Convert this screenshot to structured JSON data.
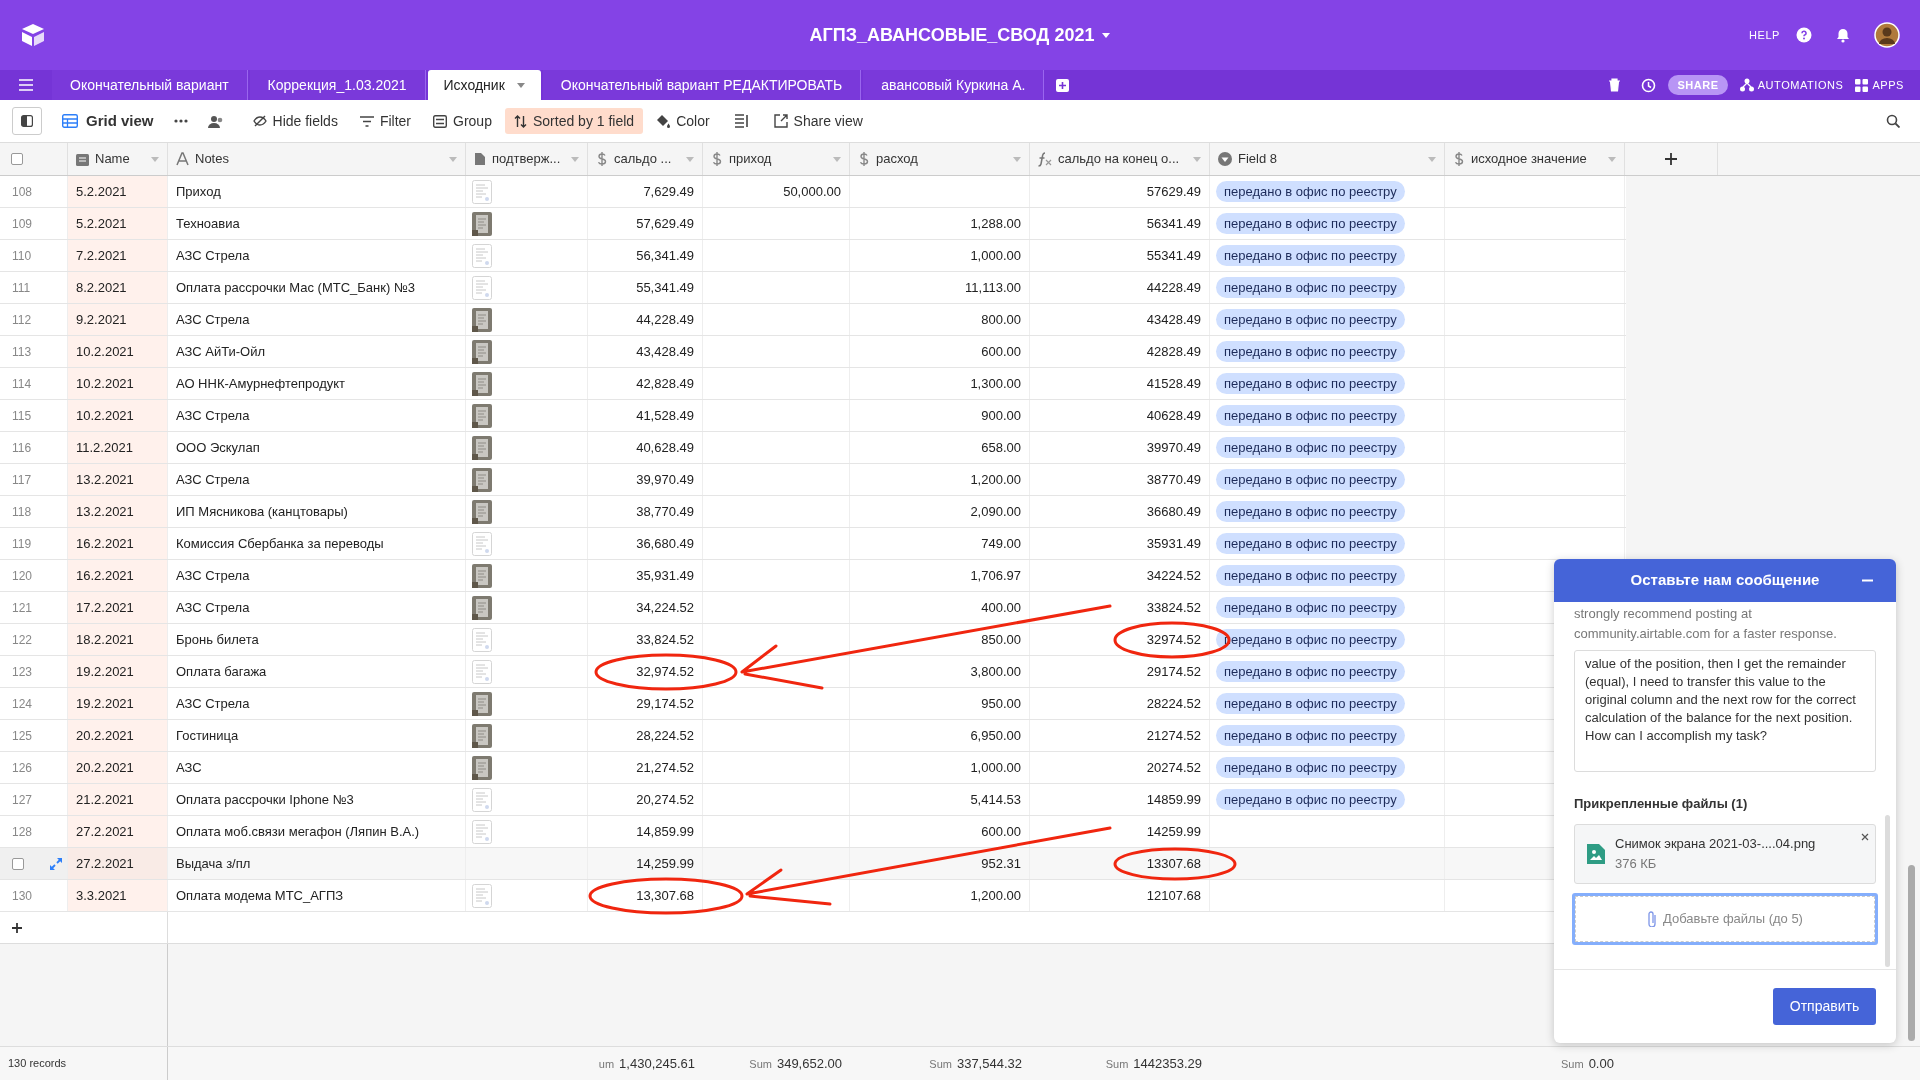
{
  "base": {
    "title": "АГПЗ_АВАНСОВЫЕ_СВОД 2021",
    "help": "HELP"
  },
  "tabs": [
    {
      "label": "Окончательный вариант",
      "selected": false
    },
    {
      "label": "Коррекция_1.03.2021",
      "selected": false
    },
    {
      "label": "Исходник",
      "selected": true
    },
    {
      "label": "Окончательный вариант РЕДАКТИРОВАТЬ",
      "selected": false
    },
    {
      "label": "авансовый Куркина А.",
      "selected": false
    }
  ],
  "tab_actions": {
    "share": "SHARE",
    "automations": "AUTOMATIONS",
    "apps": "APPS"
  },
  "toolbar": {
    "view": "Grid view",
    "buttons": [
      {
        "label": "Hide fields",
        "kind": "hide",
        "active": false
      },
      {
        "label": "Filter",
        "kind": "filter",
        "active": false
      },
      {
        "label": "Group",
        "kind": "group",
        "active": false
      },
      {
        "label": "Sorted by 1 field",
        "kind": "sort",
        "active": true
      },
      {
        "label": "Color",
        "kind": "color",
        "active": false
      }
    ],
    "share_view": "Share view"
  },
  "table": {
    "columns": [
      {
        "label": "Name",
        "kind": "date"
      },
      {
        "label": "Notes",
        "kind": "text"
      },
      {
        "label": "подтверж...",
        "kind": "attachment"
      },
      {
        "label": "сальдо ...",
        "kind": "currency",
        "summary": {
          "label": "um",
          "value": "1,430,245.61"
        }
      },
      {
        "label": "приход",
        "kind": "currency",
        "summary": {
          "label": "Sum",
          "value": "349,652.00"
        }
      },
      {
        "label": "расход",
        "kind": "currency",
        "summary": {
          "label": "Sum",
          "value": "337,544.32"
        }
      },
      {
        "label": "сальдо на конец о...",
        "kind": "formula",
        "summary": {
          "label": "Sum",
          "value": "1442353.29"
        }
      },
      {
        "label": "Field 8",
        "kind": "select"
      },
      {
        "label": "исходное значение",
        "kind": "currency",
        "summary": {
          "label": "Sum",
          "value": "0.00"
        }
      }
    ],
    "rows": [
      {
        "number": "108",
        "name": "5.2.2021",
        "notes": "Приход",
        "attachment": {
          "kind": "document"
        },
        "saldo": "7,629.49",
        "income": "50,000.00",
        "end_balance": "57629.49",
        "field_8": "передано в офис по реестру",
        "hovered": false
      },
      {
        "number": "109",
        "name": "5.2.2021",
        "notes": "Техноавиа",
        "attachment": {
          "kind": "photo"
        },
        "saldo": "57,629.49",
        "expense": "1,288.00",
        "end_balance": "56341.49",
        "field_8": "передано в офис по реестру",
        "hovered": false
      },
      {
        "number": "110",
        "name": "7.2.2021",
        "notes": "АЗС Стрела",
        "attachment": {
          "kind": "document"
        },
        "saldo": "56,341.49",
        "expense": "1,000.00",
        "end_balance": "55341.49",
        "field_8": "передано в офис по реестру",
        "hovered": false
      },
      {
        "number": "111",
        "name": "8.2.2021",
        "notes": "Оплата рассрочки Мас (МТС_Банк) №3",
        "attachment": {
          "kind": "document"
        },
        "saldo": "55,341.49",
        "expense": "11,113.00",
        "end_balance": "44228.49",
        "field_8": "передано в офис по реестру",
        "hovered": false
      },
      {
        "number": "112",
        "name": "9.2.2021",
        "notes": "АЗС Стрела",
        "attachment": {
          "kind": "photo"
        },
        "saldo": "44,228.49",
        "expense": "800.00",
        "end_balance": "43428.49",
        "field_8": "передано в офис по реестру",
        "hovered": false
      },
      {
        "number": "113",
        "name": "10.2.2021",
        "notes": "АЗС АйТи-Ойл",
        "attachment": {
          "kind": "photo"
        },
        "saldo": "43,428.49",
        "expense": "600.00",
        "end_balance": "42828.49",
        "field_8": "передано в офис по реестру",
        "hovered": false
      },
      {
        "number": "114",
        "name": "10.2.2021",
        "notes": "АО ННК-Амурнефтепродукт",
        "attachment": {
          "kind": "photo"
        },
        "saldo": "42,828.49",
        "expense": "1,300.00",
        "end_balance": "41528.49",
        "field_8": "передано в офис по реестру",
        "hovered": false
      },
      {
        "number": "115",
        "name": "10.2.2021",
        "notes": "АЗС Стрела",
        "attachment": {
          "kind": "photo"
        },
        "saldo": "41,528.49",
        "expense": "900.00",
        "end_balance": "40628.49",
        "field_8": "передано в офис по реестру",
        "hovered": false
      },
      {
        "number": "116",
        "name": "11.2.2021",
        "notes": "ООО Эскулап",
        "attachment": {
          "kind": "photo"
        },
        "saldo": "40,628.49",
        "expense": "658.00",
        "end_balance": "39970.49",
        "field_8": "передано в офис по реестру",
        "hovered": false
      },
      {
        "number": "117",
        "name": "13.2.2021",
        "notes": "АЗС Стрела",
        "attachment": {
          "kind": "photo"
        },
        "saldo": "39,970.49",
        "expense": "1,200.00",
        "end_balance": "38770.49",
        "field_8": "передано в офис по реестру",
        "hovered": false
      },
      {
        "number": "118",
        "name": "13.2.2021",
        "notes": "ИП Мясникова (канцтовары)",
        "attachment": {
          "kind": "photo"
        },
        "saldo": "38,770.49",
        "expense": "2,090.00",
        "end_balance": "36680.49",
        "field_8": "передано в офис по реестру",
        "hovered": false
      },
      {
        "number": "119",
        "name": "16.2.2021",
        "notes": "Комиссия Сбербанка за переводы",
        "attachment": {
          "kind": "document"
        },
        "saldo": "36,680.49",
        "expense": "749.00",
        "end_balance": "35931.49",
        "field_8": "передано в офис по реестру",
        "hovered": false
      },
      {
        "number": "120",
        "name": "16.2.2021",
        "notes": "АЗС Стрела",
        "attachment": {
          "kind": "photo"
        },
        "saldo": "35,931.49",
        "expense": "1,706.97",
        "end_balance": "34224.52",
        "field_8": "передано в офис по реестру",
        "hovered": false
      },
      {
        "number": "121",
        "name": "17.2.2021",
        "notes": "АЗС Стрела",
        "attachment": {
          "kind": "photo"
        },
        "saldo": "34,224.52",
        "expense": "400.00",
        "end_balance": "33824.52",
        "field_8": "передано в офис по реестру",
        "hovered": false
      },
      {
        "number": "122",
        "name": "18.2.2021",
        "notes": "Бронь билета",
        "attachment": {
          "kind": "document"
        },
        "saldo": "33,824.52",
        "expense": "850.00",
        "end_balance": "32974.52",
        "field_8": "передано в офис по реестру",
        "hovered": false
      },
      {
        "number": "123",
        "name": "19.2.2021",
        "notes": "Оплата багажа",
        "attachment": {
          "kind": "document"
        },
        "saldo": "32,974.52",
        "expense": "3,800.00",
        "end_balance": "29174.52",
        "field_8": "передано в офис по реестру",
        "hovered": false
      },
      {
        "number": "124",
        "name": "19.2.2021",
        "notes": "АЗС Стрела",
        "attachment": {
          "kind": "photo"
        },
        "saldo": "29,174.52",
        "expense": "950.00",
        "end_balance": "28224.52",
        "field_8": "передано в офис по реестру",
        "hovered": false
      },
      {
        "number": "125",
        "name": "20.2.2021",
        "notes": "Гостиница",
        "attachment": {
          "kind": "photo"
        },
        "saldo": "28,224.52",
        "expense": "6,950.00",
        "end_balance": "21274.52",
        "field_8": "передано в офис по реестру",
        "hovered": false
      },
      {
        "number": "126",
        "name": "20.2.2021",
        "notes": "АЗС",
        "attachment": {
          "kind": "photo"
        },
        "saldo": "21,274.52",
        "expense": "1,000.00",
        "end_balance": "20274.52",
        "field_8": "передано в офис по реестру",
        "hovered": false
      },
      {
        "number": "127",
        "name": "21.2.2021",
        "notes": "Оплата рассрочки Iphone №3",
        "attachment": {
          "kind": "document"
        },
        "saldo": "20,274.52",
        "expense": "5,414.53",
        "end_balance": "14859.99",
        "field_8": "передано в офис по реестру",
        "hovered": false
      },
      {
        "number": "128",
        "name": "27.2.2021",
        "notes": "Оплата моб.связи мегафон (Ляпин В.А.)",
        "attachment": {
          "kind": "document"
        },
        "saldo": "14,859.99",
        "expense": "600.00",
        "end_balance": "14259.99",
        "hovered": false
      },
      {
        "name": "27.2.2021",
        "notes": "Выдача з/пл",
        "saldo": "14,259.99",
        "expense": "952.31",
        "end_balance": "13307.68",
        "hovered": true
      },
      {
        "number": "130",
        "name": "3.3.2021",
        "notes": "Оплата модема МТС_АГПЗ",
        "attachment": {
          "kind": "document"
        },
        "saldo": "13,307.68",
        "expense": "1,200.00",
        "end_balance": "12107.68",
        "hovered": false
      }
    ],
    "records": "130 records",
    "select_all": {
      "checked": false
    }
  },
  "chat": {
    "title": "Оставьте нам сообщение",
    "intro": "strongly recommend posting at community.airtable.com for a faster response.",
    "message": "value of the position, then I get the remainder (equal), I need to transfer this value to the original column and the next row for the correct calculation of the balance for the next position. How can I accomplish my task?",
    "attachments_label": "Прикрепленные файлы (1)",
    "files": [
      {
        "name": "Снимок экрана 2021-03-....04.png",
        "size": "376 КБ"
      }
    ],
    "dropzone": "Добавьте файлы (до 5)",
    "send": "Отправить"
  }
}
